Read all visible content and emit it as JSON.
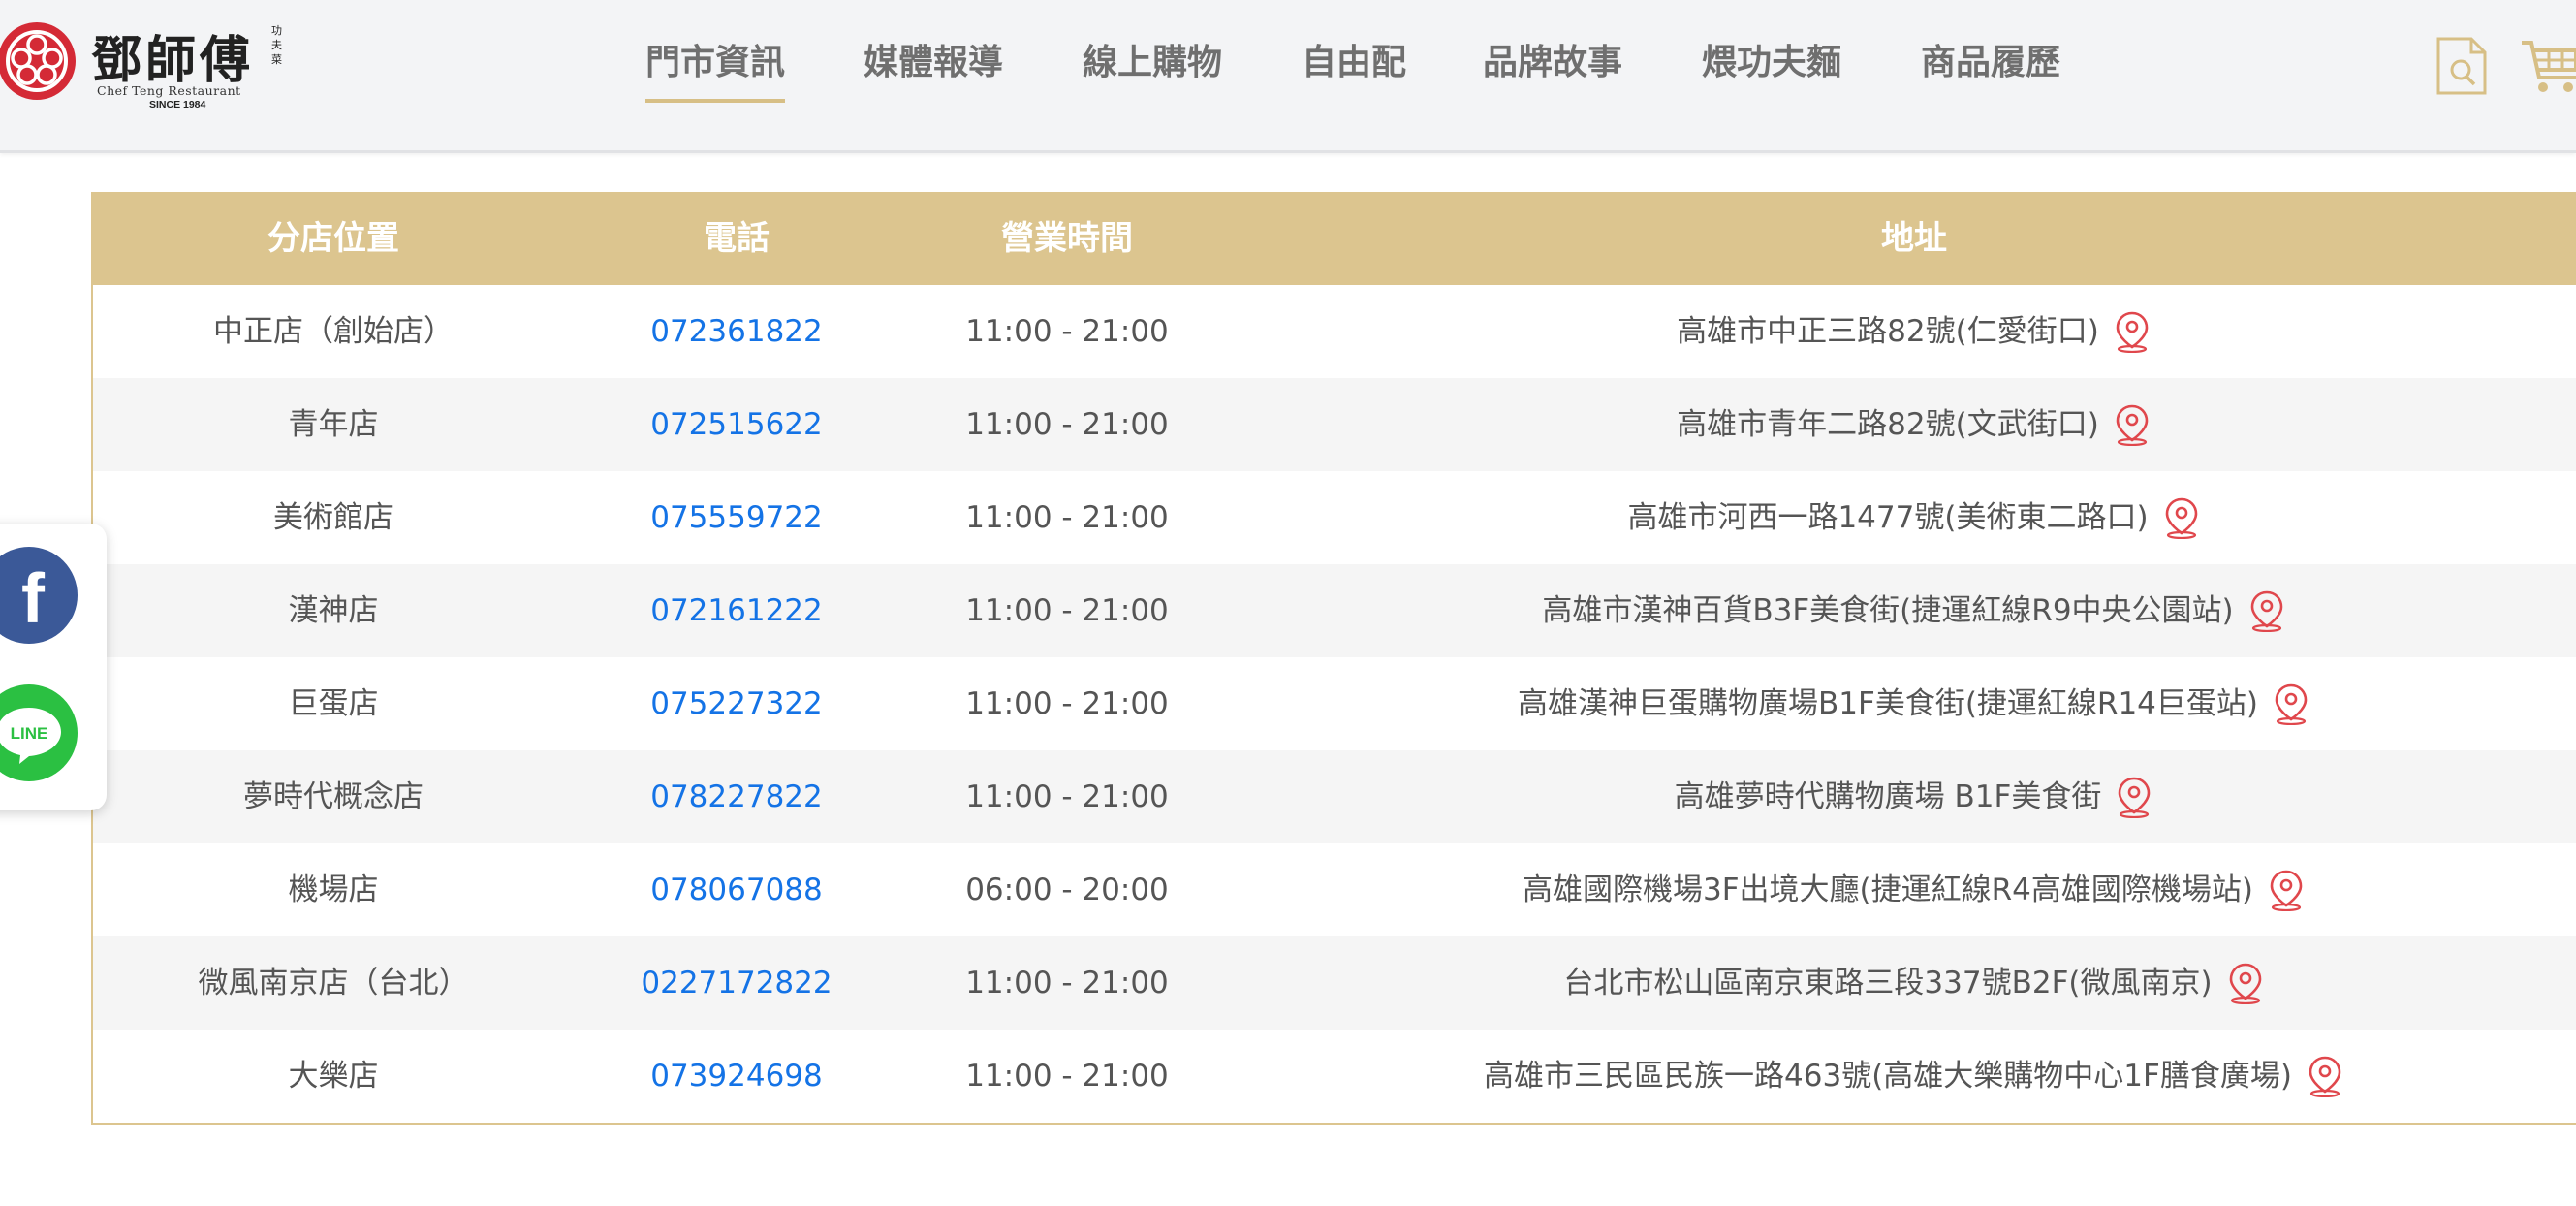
{
  "brand": {
    "name_cn": "鄧師傅",
    "side_text": "功夫菜",
    "name_en": "Chef Teng Restaurant",
    "since": "SINCE 1984"
  },
  "nav": [
    {
      "label": "門市資訊",
      "active": true
    },
    {
      "label": "媒體報導",
      "active": false
    },
    {
      "label": "線上購物",
      "active": false
    },
    {
      "label": "自由配",
      "active": false
    },
    {
      "label": "品牌故事",
      "active": false
    },
    {
      "label": "煨功夫麵",
      "active": false
    },
    {
      "label": "商品履歷",
      "active": false
    }
  ],
  "header_icons": [
    "search-document-icon",
    "shopping-cart-icon"
  ],
  "colors": {
    "accent": "#dcc58f",
    "phone": "#1473e6",
    "pin": "#e0474c",
    "facebook": "#3b5998",
    "line": "#2bc042"
  },
  "table": {
    "headers": {
      "branch": "分店位置",
      "phone": "電話",
      "hours": "營業時間",
      "address": "地址"
    },
    "rows": [
      {
        "branch": "中正店（創始店）",
        "phone": "072361822",
        "hours": "11:00 - 21:00",
        "address": "高雄市中正三路82號(仁愛街口)"
      },
      {
        "branch": "青年店",
        "phone": "072515622",
        "hours": "11:00 - 21:00",
        "address": "高雄市青年二路82號(文武街口)"
      },
      {
        "branch": "美術館店",
        "phone": "075559722",
        "hours": "11:00 - 21:00",
        "address": "高雄市河西一路1477號(美術東二路口)"
      },
      {
        "branch": "漢神店",
        "phone": "072161222",
        "hours": "11:00 - 21:00",
        "address": "高雄市漢神百貨B3F美食街(捷運紅線R9中央公園站)"
      },
      {
        "branch": "巨蛋店",
        "phone": "075227322",
        "hours": "11:00 - 21:00",
        "address": "高雄漢神巨蛋購物廣場B1F美食街(捷運紅線R14巨蛋站)"
      },
      {
        "branch": "夢時代概念店",
        "phone": "078227822",
        "hours": "11:00 - 21:00",
        "address": "高雄夢時代購物廣場 B1F美食街"
      },
      {
        "branch": "機場店",
        "phone": "078067088",
        "hours": "06:00 - 20:00",
        "address": "高雄國際機場3F出境大廳(捷運紅線R4高雄國際機場站)"
      },
      {
        "branch": "微風南京店（台北）",
        "phone": "0227172822",
        "hours": "11:00 - 21:00",
        "address": "台北市松山區南京東路三段337號B2F(微風南京)"
      },
      {
        "branch": "大樂店",
        "phone": "073924698",
        "hours": "11:00 - 21:00",
        "address": "高雄市三民區民族一路463號(高雄大樂購物中心1F膳食廣場)"
      }
    ]
  },
  "social": {
    "line_label": "LINE",
    "facebook_glyph": "f"
  }
}
